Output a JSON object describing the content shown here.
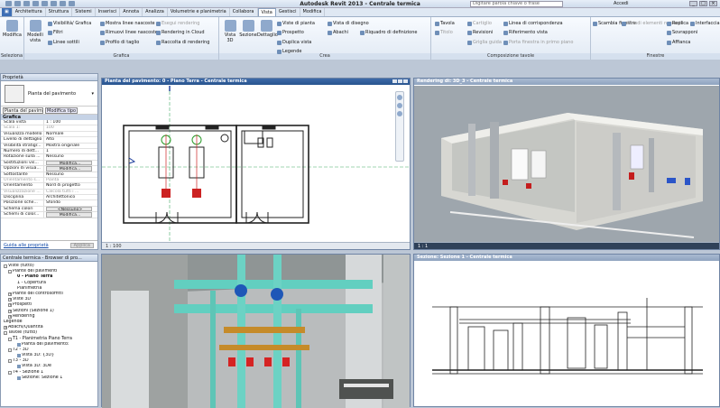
{
  "window": {
    "title": "Autodesk Revit 2013 -   Centrale termica",
    "search_placeholder": "Digitare parola chiave o frase",
    "user": "Accedi"
  },
  "tabs": [
    "Architettura",
    "Struttura",
    "Sistemi",
    "Inserisci",
    "Annota",
    "Analizza",
    "Volumetrie e planimetria",
    "Collabora",
    "Vista",
    "Gestisci",
    "Modifica"
  ],
  "ribbon": {
    "modifica": "Modifica",
    "selection_panel": "Seleziona",
    "grafica": {
      "big": [
        "Modelli vista"
      ],
      "items": [
        "Visibilità/ Grafica",
        "Filtri",
        "Linee sottili",
        "Mostra linee nascoste",
        "Rimuovi linee nascoste",
        "Profilo di taglio",
        "Esegui rendering",
        "Rendering in Cloud",
        "Raccolta di rendering"
      ],
      "label": "Grafica"
    },
    "crea": {
      "big": [
        "Vista 3D",
        "Sezione",
        "Dettaglio"
      ],
      "items": [
        "Viste di pianta",
        "Prospetto",
        "Duplica vista",
        "Legende",
        "Vista di disegno",
        "Abachi",
        "Riquadro di definizione"
      ],
      "label": "Crea"
    },
    "comp": {
      "items": [
        "Tavola",
        "Titolo",
        "Cartiglio",
        "Revisioni",
        "Griglia guida",
        "Linea di corrispondenza",
        "Riferimento vista",
        "Porta finestra in primo piano"
      ],
      "label": "Composizione tavole"
    },
    "finestre": {
      "items": [
        "Scambia finestre",
        "Chiudi elementi nascosti",
        "Replica",
        "Sovrapponi",
        "Affianca",
        "Interfaccia utente"
      ],
      "label": "Finestre"
    }
  },
  "properties": {
    "title": "Proprietà",
    "type": "Pianta del pavimento",
    "selector": "Pianta del pavim",
    "edit_type": "Modifica tipo",
    "group": "Grafica",
    "rows": [
      [
        "Scala vista",
        "1 : 100"
      ],
      [
        "Scala 1:",
        "100"
      ],
      [
        "Visualizza modello",
        "Normale"
      ],
      [
        "Livello di dettaglio",
        "Alto"
      ],
      [
        "Visibilità stratigr...",
        "Mostra originale"
      ],
      [
        "Numero di dett...",
        "1"
      ],
      [
        "Rotazione sulla ...",
        "Nessuno"
      ],
      [
        "Sostituzioni vis...",
        "Modifica..."
      ],
      [
        "Opzioni di visua...",
        "Modifica..."
      ],
      [
        "Sottostante",
        "Nessuno"
      ],
      [
        "Orientamento s...",
        "Pianta"
      ],
      [
        "Orientamento",
        "Nord di progetto"
      ],
      [
        "Visualizzazione ...",
        "Calcola tutti i ..."
      ],
      [
        "Disciplina",
        "Architettonico"
      ],
      [
        "Posizione sche...",
        "Sfondo"
      ],
      [
        "Schema colori",
        "<Nessuno>"
      ],
      [
        "Schemi di color...",
        "Modifica..."
      ]
    ],
    "help": "Guida alle proprietà",
    "apply": "Applica"
  },
  "project_browser": {
    "title": "Centrale termica - Browser di pro...",
    "nodes": [
      {
        "t": "Viste (tutto)",
        "l": 0,
        "ex": "-",
        "b": 0
      },
      {
        "t": "Piante dei pavimenti",
        "l": 1,
        "ex": "-",
        "b": 0
      },
      {
        "t": "0 - Piano Terra",
        "l": 3,
        "ex": "",
        "b": 1
      },
      {
        "t": "1 - Copertura",
        "l": 3,
        "ex": "",
        "b": 0
      },
      {
        "t": "Planimetria",
        "l": 3,
        "ex": "",
        "b": 0
      },
      {
        "t": "Piante dei controsoffitti",
        "l": 1,
        "ex": "+",
        "b": 0
      },
      {
        "t": "Viste 3D",
        "l": 1,
        "ex": "+",
        "b": 0
      },
      {
        "t": "Prospetti",
        "l": 1,
        "ex": "+",
        "b": 0
      },
      {
        "t": "Sezioni (Sezione 1)",
        "l": 1,
        "ex": "+",
        "b": 0
      },
      {
        "t": "Rendering",
        "l": 1,
        "ex": "+",
        "b": 0
      },
      {
        "t": "Legende",
        "l": 0,
        "ex": "",
        "b": 0
      },
      {
        "t": "Abachi/Quantità",
        "l": 0,
        "ex": "+",
        "b": 0
      },
      {
        "t": "Tavole (tutto)",
        "l": 0,
        "ex": "-",
        "b": 0
      },
      {
        "t": "T1 - Planimetria Piano Terra",
        "l": 1,
        "ex": "-",
        "b": 0
      },
      {
        "t": "Pianta del pavimento:",
        "l": 3,
        "ex": "",
        "b": 0,
        "i": 1
      },
      {
        "t": "T2 - 3D",
        "l": 1,
        "ex": "-",
        "b": 0
      },
      {
        "t": "Vista 3D: {3D}",
        "l": 3,
        "ex": "",
        "b": 0,
        "i": 1
      },
      {
        "t": "T3 - 3D",
        "l": 1,
        "ex": "-",
        "b": 0
      },
      {
        "t": "Vista 3D: 3De",
        "l": 3,
        "ex": "",
        "b": 0,
        "i": 1
      },
      {
        "t": "T4 - Sezione 1",
        "l": 1,
        "ex": "-",
        "b": 0
      },
      {
        "t": "Sezione: Sezione 1",
        "l": 3,
        "ex": "",
        "b": 0,
        "i": 1
      }
    ]
  },
  "views": {
    "plan": "Pianta del pavimento: 0 - Piano Terra - Centrale termica",
    "render": "Rendering di: 3D_3 - Centrale termica",
    "section": "Sezione: Sezione 1 - Centrale termica",
    "scale": "1 : 100",
    "scale2": "1 : 1"
  }
}
